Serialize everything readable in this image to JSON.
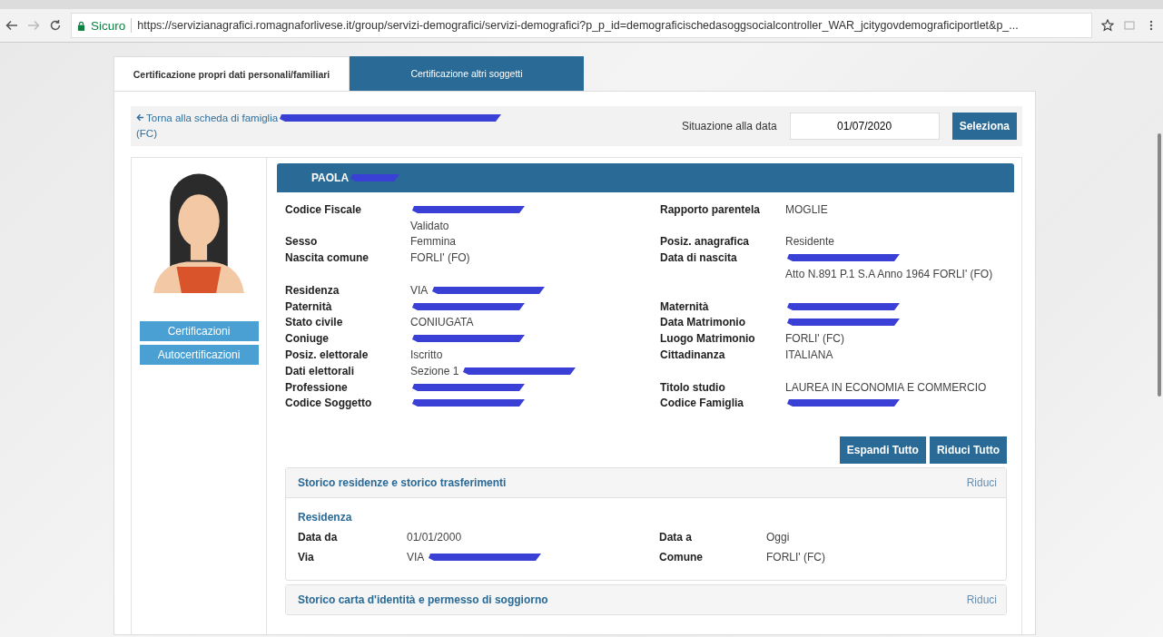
{
  "browser": {
    "secure_label": "Sicuro",
    "url": "https://servizianagrafici.romagnaforlivese.it/group/servizi-demografici/servizi-demografici?p_p_id=demograficischedasoggsocialcontroller_WAR_jcitygovdemograficiportlet&p_..."
  },
  "tabs": [
    {
      "label": "Certificazione propri dati personali/familiari",
      "selected": true
    },
    {
      "label": "Certificazione altri soggetti",
      "selected": false
    }
  ],
  "toolbar": {
    "back_link": "Torna alla scheda di famiglia",
    "back_link_redacted": true,
    "back_link_tail": "(FC)",
    "date_label": "Situazione alla data",
    "date_value": "01/07/2020",
    "select_button": "Seleziona"
  },
  "side_buttons": [
    "Certificazioni",
    "Autocertificazioni"
  ],
  "person": {
    "name": "PAOLA",
    "name_redacted": true
  },
  "fields": [
    {
      "left": {
        "label": "Codice Fiscale",
        "redacted": true
      },
      "right": {
        "label": "Rapporto parentela",
        "value": "MOGLIE"
      }
    },
    {
      "left": {
        "value": "Validato"
      }
    },
    {
      "left": {
        "label": "Sesso",
        "value": "Femmina"
      },
      "right": {
        "label": "Posiz. anagrafica",
        "value": "Residente"
      }
    },
    {
      "left": {
        "label": "Nascita comune",
        "value": "FORLI' (FO)"
      },
      "right": {
        "label": "Data di nascita",
        "redacted": true
      }
    },
    {
      "right": {
        "value": "Atto N.891 P.1 S.A Anno 1964 FORLI' (FO)"
      }
    },
    {
      "left": {
        "label": "Residenza",
        "value": "VIA",
        "redacted": true
      }
    },
    {
      "left": {
        "label": "Paternità",
        "redacted": true
      },
      "right": {
        "label": "Maternità",
        "redacted": true
      }
    },
    {
      "left": {
        "label": "Stato civile",
        "value": "CONIUGATA"
      },
      "right": {
        "label": "Data Matrimonio",
        "redacted": true
      }
    },
    {
      "left": {
        "label": "Coniuge",
        "redacted": true
      },
      "right": {
        "label": "Luogo Matrimonio",
        "value": "FORLI' (FC)"
      }
    },
    {
      "left": {
        "label": "Posiz. elettorale",
        "value": "Iscritto"
      },
      "right": {
        "label": "Cittadinanza",
        "value": "ITALIANA"
      }
    },
    {
      "left": {
        "label": "Dati elettorali",
        "value": "Sezione 1",
        "redacted": true
      }
    },
    {
      "left": {
        "label": "Professione",
        "redacted": true
      },
      "right": {
        "label": "Titolo studio",
        "value": "LAUREA IN ECONOMIA E COMMERCIO"
      }
    },
    {
      "left": {
        "label": "Codice Soggetto",
        "redacted": true
      },
      "right": {
        "label": "Codice Famiglia",
        "redacted": true
      }
    }
  ],
  "actions": [
    "Espandi Tutto",
    "Riduci Tutto"
  ],
  "sections": [
    {
      "title": "Storico residenze e storico trasferimenti",
      "toggle": "Riduci",
      "expanded": true,
      "subtitle": "Residenza",
      "rows": [
        {
          "left": {
            "label": "Data da",
            "value": "01/01/2000"
          },
          "right": {
            "label": "Data a",
            "value": "Oggi"
          }
        },
        {
          "left": {
            "label": "Via",
            "value": "VIA",
            "redacted": true
          },
          "right": {
            "label": "Comune",
            "value": "FORLI' (FC)"
          }
        }
      ]
    },
    {
      "title": "Storico carta d'identità e permesso di soggiorno",
      "toggle": "Riduci",
      "expanded": false
    }
  ]
}
